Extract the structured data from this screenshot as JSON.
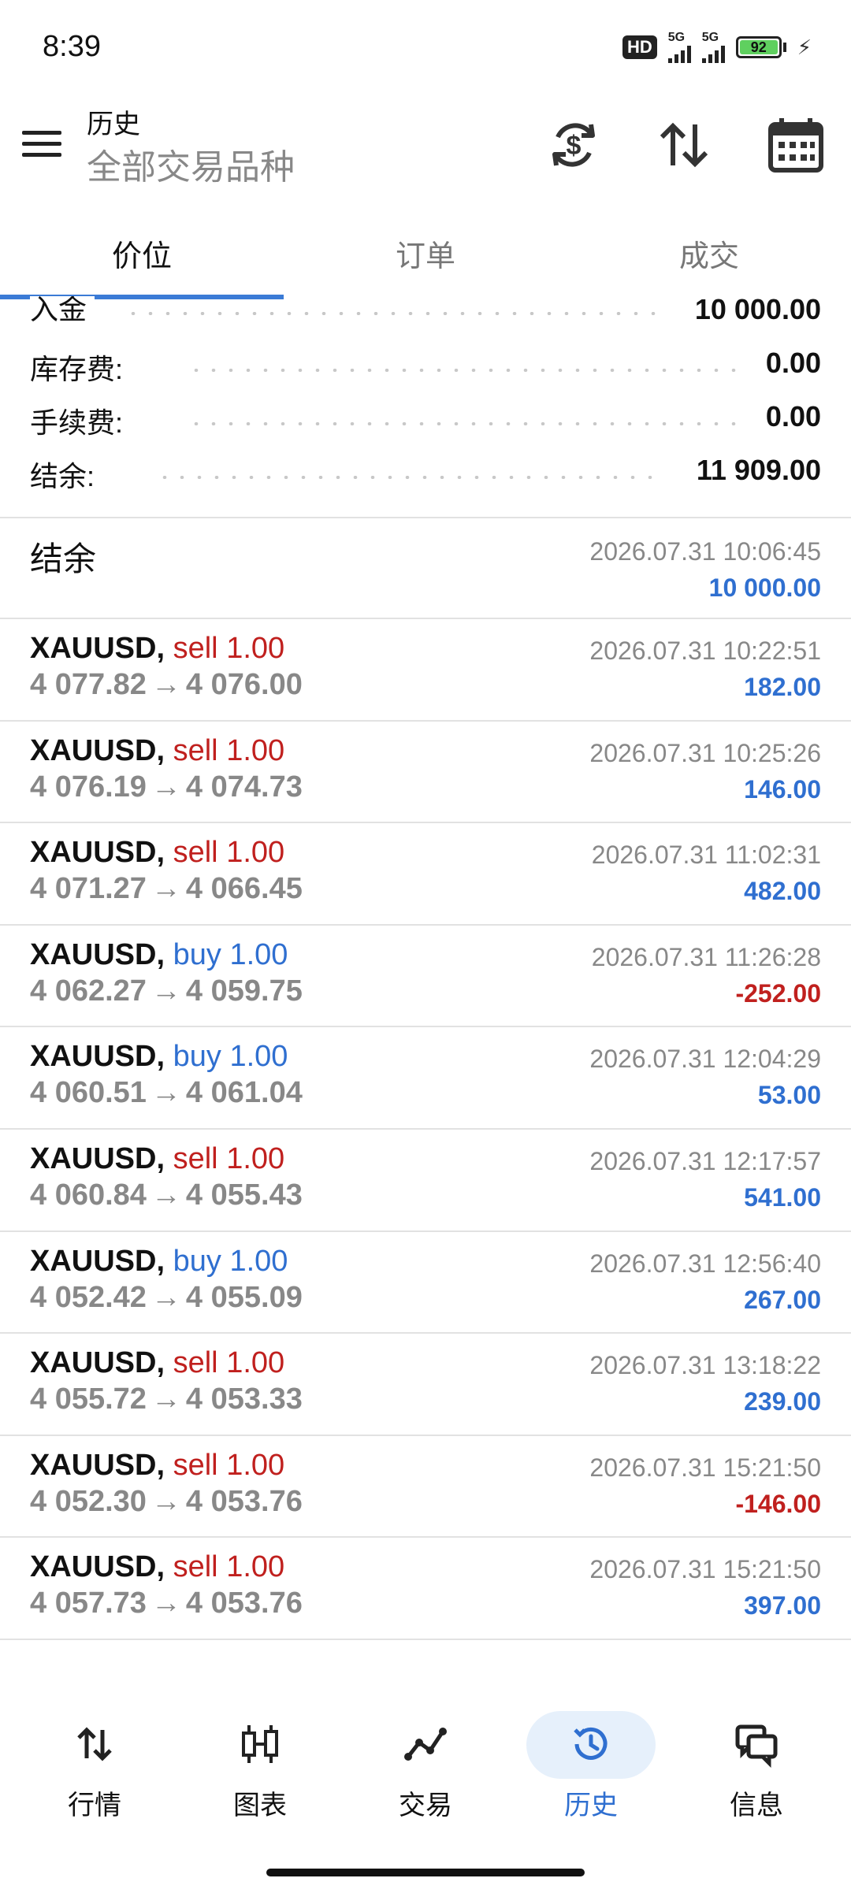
{
  "status_bar": {
    "time": "8:39",
    "hd_badge": "HD",
    "signal1": "5G",
    "signal2": "5G",
    "battery": "92"
  },
  "header": {
    "title": "历史",
    "subtitle": "全部交易品种",
    "icons": [
      "currency-sync-icon",
      "sort-icon",
      "calendar-icon"
    ]
  },
  "tabs": [
    {
      "label": "价位",
      "active": true
    },
    {
      "label": "订单",
      "active": false
    },
    {
      "label": "成交",
      "active": false
    }
  ],
  "summary": [
    {
      "label": "入金",
      "value": "10 000.00"
    },
    {
      "label": "库存费:",
      "value": "0.00"
    },
    {
      "label": "手续费:",
      "value": "0.00"
    },
    {
      "label": "结余:",
      "value": "11 909.00"
    }
  ],
  "balance_entry": {
    "title": "结余",
    "time": "2026.07.31 10:06:45",
    "amount": "10 000.00"
  },
  "deals": [
    {
      "symbol": "XAUUSD",
      "type": "sell",
      "volume": "1.00",
      "open": "4 077.82",
      "close": "4 076.00",
      "time": "2026.07.31 10:22:51",
      "profit": "182.00"
    },
    {
      "symbol": "XAUUSD",
      "type": "sell",
      "volume": "1.00",
      "open": "4 076.19",
      "close": "4 074.73",
      "time": "2026.07.31 10:25:26",
      "profit": "146.00"
    },
    {
      "symbol": "XAUUSD",
      "type": "sell",
      "volume": "1.00",
      "open": "4 071.27",
      "close": "4 066.45",
      "time": "2026.07.31 11:02:31",
      "profit": "482.00"
    },
    {
      "symbol": "XAUUSD",
      "type": "buy",
      "volume": "1.00",
      "open": "4 062.27",
      "close": "4 059.75",
      "time": "2026.07.31 11:26:28",
      "profit": "-252.00"
    },
    {
      "symbol": "XAUUSD",
      "type": "buy",
      "volume": "1.00",
      "open": "4 060.51",
      "close": "4 061.04",
      "time": "2026.07.31 12:04:29",
      "profit": "53.00"
    },
    {
      "symbol": "XAUUSD",
      "type": "sell",
      "volume": "1.00",
      "open": "4 060.84",
      "close": "4 055.43",
      "time": "2026.07.31 12:17:57",
      "profit": "541.00"
    },
    {
      "symbol": "XAUUSD",
      "type": "buy",
      "volume": "1.00",
      "open": "4 052.42",
      "close": "4 055.09",
      "time": "2026.07.31 12:56:40",
      "profit": "267.00"
    },
    {
      "symbol": "XAUUSD",
      "type": "sell",
      "volume": "1.00",
      "open": "4 055.72",
      "close": "4 053.33",
      "time": "2026.07.31 13:18:22",
      "profit": "239.00"
    },
    {
      "symbol": "XAUUSD",
      "type": "sell",
      "volume": "1.00",
      "open": "4 052.30",
      "close": "4 053.76",
      "time": "2026.07.31 15:21:50",
      "profit": "-146.00"
    },
    {
      "symbol": "XAUUSD",
      "type": "sell",
      "volume": "1.00",
      "open": "4 057.73",
      "close": "4 053.76",
      "time": "2026.07.31 15:21:50",
      "profit": "397.00"
    }
  ],
  "bottom_nav": [
    {
      "label": "行情",
      "icon": "quotes-icon",
      "active": false
    },
    {
      "label": "图表",
      "icon": "chart-icon",
      "active": false
    },
    {
      "label": "交易",
      "icon": "trade-icon",
      "active": false
    },
    {
      "label": "历史",
      "icon": "history-icon",
      "active": true
    },
    {
      "label": "信息",
      "icon": "messages-icon",
      "active": false
    }
  ],
  "colors": {
    "accent": "#3b7bd6",
    "sell": "#c0201e",
    "buy": "#2f6fd0",
    "profit_positive": "#2f6fd0",
    "profit_negative": "#c0201e",
    "muted": "#888888"
  }
}
